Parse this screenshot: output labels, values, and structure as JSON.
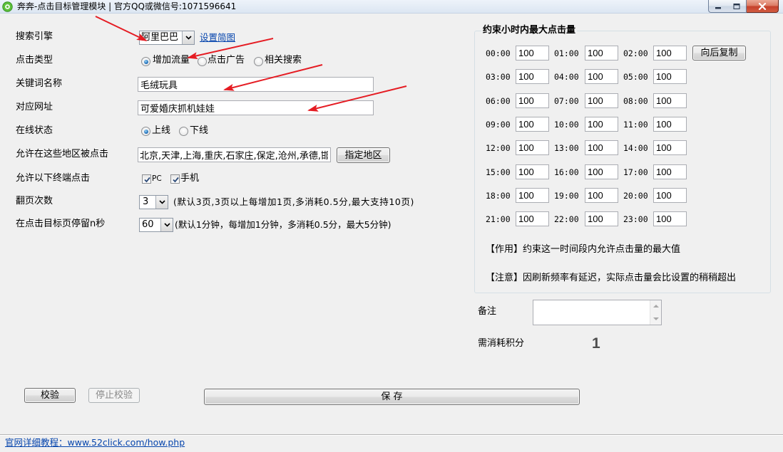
{
  "window": {
    "title": "奔奔-点击目标管理模块 | 官方QQ或微信号:1071596641"
  },
  "icons": {
    "app": "app-logo-icon",
    "minimize": "minimize-icon",
    "maximize": "maximize-icon",
    "close": "close-icon",
    "dropdown": "chevron-down-icon",
    "checkbox": "checkmark-icon"
  },
  "form": {
    "search_engine": {
      "label": "搜索引擎",
      "value": "阿里巴巴",
      "link": "设置简图"
    },
    "click_type": {
      "label": "点击类型",
      "options": [
        {
          "label": "增加流量",
          "checked": true
        },
        {
          "label": "点击广告",
          "checked": false
        },
        {
          "label": "相关搜索",
          "checked": false
        }
      ]
    },
    "keyword": {
      "label": "关键词名称",
      "value": "毛绒玩具"
    },
    "url": {
      "label": "对应网址",
      "value": "可爱婚庆抓机娃娃"
    },
    "online_status": {
      "label": "在线状态",
      "options": [
        {
          "label": "上线",
          "checked": true
        },
        {
          "label": "下线",
          "checked": false
        }
      ]
    },
    "regions": {
      "label": "允许在这些地区被点击",
      "value": "北京,天津,上海,重庆,石家庄,保定,沧州,承德,邯",
      "button": "指定地区"
    },
    "terminals": {
      "label": "允许以下终端点击",
      "options": [
        {
          "label": "PC",
          "checked": true
        },
        {
          "label": "手机",
          "checked": true
        }
      ]
    },
    "pages": {
      "label": "翻页次数",
      "value": "3",
      "hint": "(默认3页,3页以上每增加1页,多消耗0.5分,最大支持10页)"
    },
    "dwell": {
      "label": "在点击目标页停留n秒",
      "value": "60",
      "hint": "(默认1分钟，每增加1分钟，多消耗0.5分，最大5分钟)"
    }
  },
  "hourly_limits": {
    "title": "约束小时内最大点击量",
    "copy_button": "向后复制",
    "hours": [
      {
        "time": "00:00",
        "value": "100"
      },
      {
        "time": "01:00",
        "value": "100"
      },
      {
        "time": "02:00",
        "value": "100"
      },
      {
        "time": "03:00",
        "value": "100"
      },
      {
        "time": "04:00",
        "value": "100"
      },
      {
        "time": "05:00",
        "value": "100"
      },
      {
        "time": "06:00",
        "value": "100"
      },
      {
        "time": "07:00",
        "value": "100"
      },
      {
        "time": "08:00",
        "value": "100"
      },
      {
        "time": "09:00",
        "value": "100"
      },
      {
        "time": "10:00",
        "value": "100"
      },
      {
        "time": "11:00",
        "value": "100"
      },
      {
        "time": "12:00",
        "value": "100"
      },
      {
        "time": "13:00",
        "value": "100"
      },
      {
        "time": "14:00",
        "value": "100"
      },
      {
        "time": "15:00",
        "value": "100"
      },
      {
        "time": "16:00",
        "value": "100"
      },
      {
        "time": "17:00",
        "value": "100"
      },
      {
        "time": "18:00",
        "value": "100"
      },
      {
        "time": "19:00",
        "value": "100"
      },
      {
        "time": "20:00",
        "value": "100"
      },
      {
        "time": "21:00",
        "value": "100"
      },
      {
        "time": "22:00",
        "value": "100"
      },
      {
        "time": "23:00",
        "value": "100"
      }
    ],
    "note_purpose": "【作用】约束这一时间段内允许点击量的最大值",
    "note_caution": "【注意】因刷新频率有延迟，实际点击量会比设置的稍稍超出"
  },
  "remarks": {
    "label": "备注",
    "value": ""
  },
  "cost": {
    "label": "需消耗积分",
    "value": "1"
  },
  "actions": {
    "verify": "校验",
    "stop_verify": "停止校验",
    "save": "保 存"
  },
  "footer": {
    "link": "官网详细教程：www.52click.com/how.php"
  },
  "colors": {
    "link": "#0645ad",
    "annotation_arrow": "#e51c23",
    "close_button": "#c5412b",
    "radio_dot": "#2a78c0"
  }
}
